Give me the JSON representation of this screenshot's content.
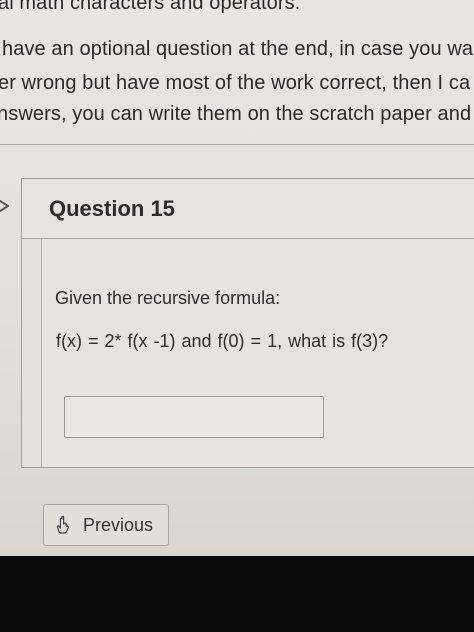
{
  "instructions": [
    "al math characters and operators.",
    "have an optional question at the end, in case you wa",
    "er wrong but have most of the work correct, then I ca",
    "nswers, you can write them on the scratch paper and"
  ],
  "question": {
    "title": "Question 15",
    "prompt": "Given the recursive formula:",
    "formula": "f(x) = 2* f(x -1)  and f(0) = 1, what is f(3)?",
    "answer_value": ""
  },
  "navigation": {
    "previous_label": "Previous",
    "previous_icon": "pointer-hand-icon"
  },
  "flag_icon": "chevron-right-icon"
}
